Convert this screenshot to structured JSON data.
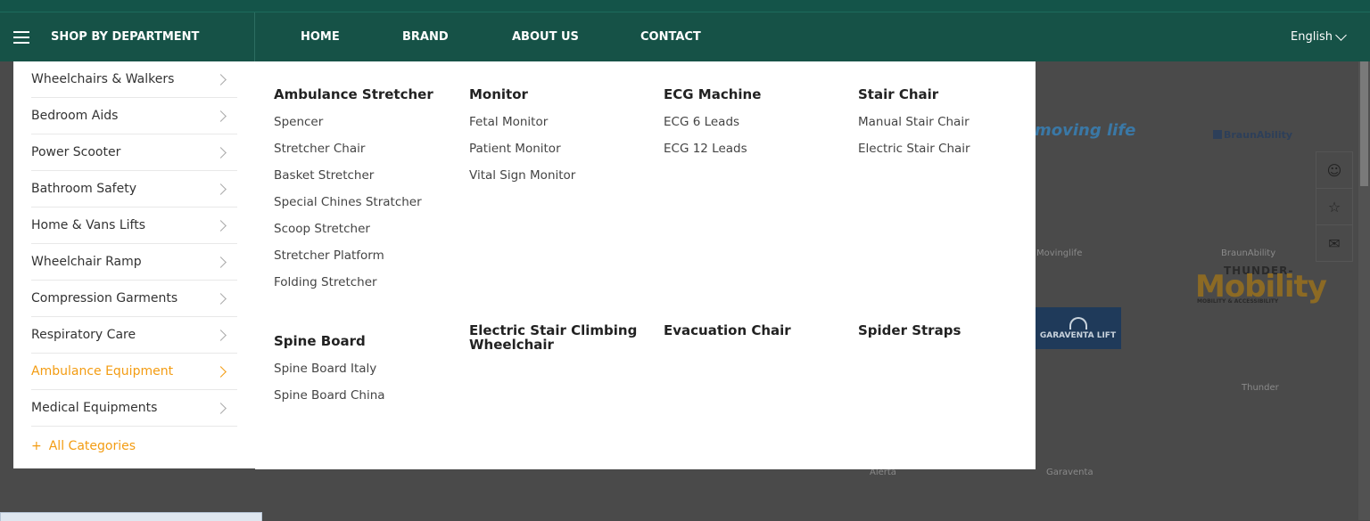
{
  "header": {
    "department_label": "SHOP BY DEPARTMENT",
    "nav": [
      "HOME",
      "BRAND",
      "ABOUT US",
      "CONTACT"
    ],
    "language": "English"
  },
  "sidebar": {
    "items": [
      {
        "label": "Wheelchairs & Walkers",
        "active": false
      },
      {
        "label": "Bedroom Aids",
        "active": false
      },
      {
        "label": "Power Scooter",
        "active": false
      },
      {
        "label": "Bathroom Safety",
        "active": false
      },
      {
        "label": "Home & Vans Lifts",
        "active": false
      },
      {
        "label": "Wheelchair Ramp",
        "active": false
      },
      {
        "label": "Compression Garments",
        "active": false
      },
      {
        "label": "Respiratory Care",
        "active": false
      },
      {
        "label": "Ambulance Equipment",
        "active": true
      },
      {
        "label": "Medical Equipments",
        "active": false
      }
    ],
    "all_categories": "All Categories",
    "accent_color": "#f39c12"
  },
  "mega_menu": {
    "row1": [
      {
        "heading": "Ambulance Stretcher",
        "links": [
          "Spencer",
          "Stretcher Chair",
          "Basket Stretcher",
          "Special Chines Stratcher",
          "Scoop Stretcher",
          "Stretcher Platform",
          "Folding Stretcher"
        ]
      },
      {
        "heading": "Monitor",
        "links": [
          "Fetal Monitor",
          "Patient Monitor",
          "Vital Sign Monitor"
        ]
      },
      {
        "heading": "ECG Machine",
        "links": [
          "ECG 6 Leads",
          "ECG 12 Leads"
        ]
      },
      {
        "heading": "Stair Chair",
        "links": [
          "Manual Stair Chair",
          "Electric Stair Chair"
        ]
      }
    ],
    "row2": [
      {
        "heading": "Spine Board",
        "links": [
          "Spine Board Italy",
          "Spine Board China"
        ]
      },
      {
        "heading": "Electric Stair Climbing Wheelchair",
        "links": []
      },
      {
        "heading": "Evacuation Chair",
        "links": []
      },
      {
        "heading": "Spider Straps",
        "links": []
      }
    ]
  },
  "brands": {
    "movinglife_logo": "moving life",
    "movinglife_name": "Movinglife",
    "braunability_logo": "BraunAbility",
    "braunability_name": "BraunAbility",
    "garaventa_logo": "GARAVENTA LIFT",
    "garaventa_name": "Garaventa",
    "alerta_name": "Alerta",
    "thunder_logo_top": "THUNDER-",
    "thunder_logo_big": "Mobility",
    "thunder_logo_sub": "MOBILITY & ACCESSIBILITY",
    "thunder_name": "Thunder"
  },
  "side_icons": [
    "user-icon",
    "star-icon",
    "mail-icon"
  ],
  "colors": {
    "navbar": "#165247",
    "accent": "#f39c12"
  },
  "status_url": "https://thundermobility.com/cat/ambulance-equipment"
}
